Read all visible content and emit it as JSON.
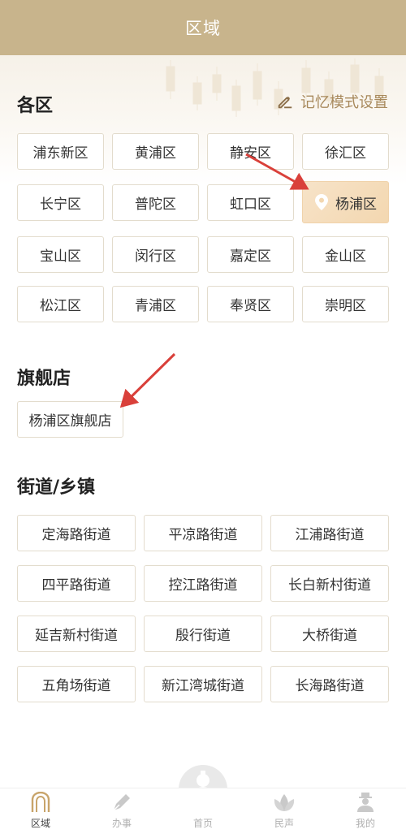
{
  "header": {
    "title": "区域"
  },
  "sections": {
    "districts_title": "各区",
    "memory_label": "记忆模式设置",
    "flagship_title": "旗舰店",
    "streets_title": "街道/乡镇"
  },
  "districts": [
    "浦东新区",
    "黄浦区",
    "静安区",
    "徐汇区",
    "长宁区",
    "普陀区",
    "虹口区",
    "杨浦区",
    "宝山区",
    "闵行区",
    "嘉定区",
    "金山区",
    "松江区",
    "青浦区",
    "奉贤区",
    "崇明区"
  ],
  "selected_district": "杨浦区",
  "flagship": {
    "label": "杨浦区旗舰店"
  },
  "streets": [
    "定海路街道",
    "平凉路街道",
    "江浦路街道",
    "四平路街道",
    "控江路街道",
    "长白新村街道",
    "延吉新村街道",
    "殷行街道",
    "大桥街道",
    "五角场街道",
    "新江湾城街道",
    "长海路街道"
  ],
  "tabs": [
    {
      "label": "区域",
      "icon": "arch-icon",
      "active": true
    },
    {
      "label": "办事",
      "icon": "pen-icon",
      "active": false
    },
    {
      "label": "首页",
      "icon": "gourd-icon",
      "active": false
    },
    {
      "label": "民声",
      "icon": "lotus-icon",
      "active": false
    },
    {
      "label": "我的",
      "icon": "person-icon",
      "active": false
    }
  ],
  "colors": {
    "header": "#c8b48c",
    "accent_text": "#a8895c",
    "selected_bg": "#f3d7b0",
    "arrow": "#d9403a"
  }
}
